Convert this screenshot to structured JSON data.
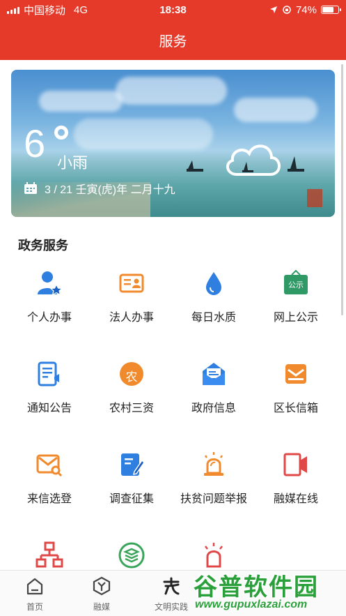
{
  "status_bar": {
    "carrier": "中国移动",
    "network": "4G",
    "time": "18:38",
    "battery": "74%"
  },
  "nav": {
    "title": "服务"
  },
  "weather": {
    "temperature": "6",
    "condition": "小雨",
    "date": "3 / 21  壬寅(虎)年 二月十九"
  },
  "section": {
    "title": "政务服务"
  },
  "services": [
    {
      "label": "个人办事",
      "icon": "person-star-icon"
    },
    {
      "label": "法人办事",
      "icon": "id-card-icon"
    },
    {
      "label": "每日水质",
      "icon": "water-drop-icon"
    },
    {
      "label": "网上公示",
      "icon": "notice-board-icon",
      "badge": "公示"
    },
    {
      "label": "通知公告",
      "icon": "announcement-icon"
    },
    {
      "label": "农村三资",
      "icon": "agriculture-icon",
      "badge": "农"
    },
    {
      "label": "政府信息",
      "icon": "open-mail-icon"
    },
    {
      "label": "区长信箱",
      "icon": "mailbox-icon"
    },
    {
      "label": "来信选登",
      "icon": "mail-search-icon"
    },
    {
      "label": "调查征集",
      "icon": "survey-edit-icon"
    },
    {
      "label": "扶贫问题举报",
      "icon": "alarm-light-icon"
    },
    {
      "label": "融媒在线",
      "icon": "video-camera-icon"
    },
    {
      "label": "",
      "icon": "org-chart-icon"
    },
    {
      "label": "",
      "icon": "layers-circle-icon"
    },
    {
      "label": "",
      "icon": "siren-icon"
    }
  ],
  "tabs": [
    {
      "label": "首页",
      "icon": "home-icon"
    },
    {
      "label": "融媒",
      "icon": "hexagon-y-icon"
    },
    {
      "label": "文明实践",
      "icon": "civilization-logo-icon"
    }
  ],
  "watermark": {
    "title": "谷普软件园",
    "url": "www.gupuxlazai.com"
  },
  "colors": {
    "brand_red": "#e53a2a",
    "icon_blue": "#2f7fe0",
    "icon_orange": "#f08a2c",
    "icon_green": "#2f9a66",
    "icon_red": "#e04848"
  }
}
